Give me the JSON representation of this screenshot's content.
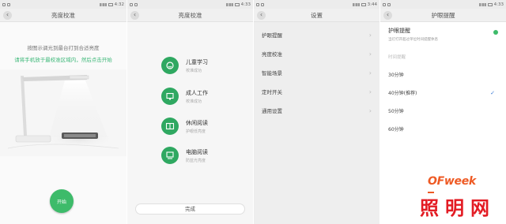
{
  "status_times": [
    "4:32",
    "4:33",
    "3:44",
    "4:33"
  ],
  "panel1": {
    "title": "亮度校准",
    "hint_line1": "按图示调光到最台打到合适亮度",
    "hint_line2": "请将手机放于最校准区域内，然后点击开始",
    "start_label": "开始"
  },
  "panel2": {
    "title": "亮度校准",
    "modes": [
      {
        "title": "儿童学习",
        "subtitle": "校准成功",
        "icon": "child-study-icon"
      },
      {
        "title": "成人工作",
        "subtitle": "校准成功",
        "icon": "monitor-icon"
      },
      {
        "title": "休闲阅读",
        "subtitle": "护眼低亮度",
        "icon": "book-icon"
      },
      {
        "title": "电脑阅读",
        "subtitle": "防蓝光亮度",
        "icon": "computer-icon"
      }
    ],
    "done_label": "完成"
  },
  "panel3": {
    "title": "设置",
    "items": [
      "护眼提醒",
      "亮度校准",
      "智能场景",
      "定时开关",
      "通用设置"
    ]
  },
  "panel4": {
    "title": "护眼提醒",
    "eye_title": "护眼提醒",
    "eye_sub": "当灯打开超过单位时间提醒休息",
    "section_label": "时间提醒",
    "options": [
      {
        "label": "30分钟",
        "checked": false
      },
      {
        "label": "40分钟(推荐)",
        "checked": true
      },
      {
        "label": "50分钟",
        "checked": false
      },
      {
        "label": "60分钟",
        "checked": false
      }
    ]
  },
  "watermark": {
    "brand": "OFweek",
    "site": "照明网"
  },
  "colors": {
    "accent_green": "#3dbb6a",
    "check_blue": "#3a7bd5",
    "watermark_red": "#e31b23"
  }
}
